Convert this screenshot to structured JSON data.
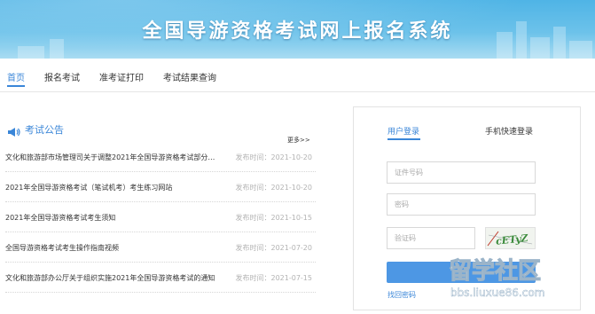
{
  "header": {
    "title": "全国导游资格考试网上报名系统"
  },
  "nav": {
    "items": [
      {
        "label": "首页",
        "active": true
      },
      {
        "label": "报名考试",
        "active": false
      },
      {
        "label": "准考证打印",
        "active": false
      },
      {
        "label": "考试结果查询",
        "active": false
      }
    ]
  },
  "notices": {
    "title": "考试公告",
    "icon": "megaphone-icon",
    "more_label": "更多>>",
    "items": [
      {
        "title": "文化和旅游部市场管理司关于调整2021年全国导游资格考试部分…",
        "date": "发布时间：2021-10-20"
      },
      {
        "title": "2021年全国导游资格考试（笔试机考）考生练习网站",
        "date": "发布时间：2021-10-20"
      },
      {
        "title": "2021年全国导游资格考试考生须知",
        "date": "发布时间：2021-10-15"
      },
      {
        "title": "全国导游资格考试考生操作指南视频",
        "date": "发布时间：2021-07-20"
      },
      {
        "title": "文化和旅游部办公厅关于组织实施2021年全国导游资格考试的通知",
        "date": "发布时间：2021-07-15"
      }
    ]
  },
  "login": {
    "tabs": [
      {
        "label": "用户登录",
        "active": true
      },
      {
        "label": "手机快速登录",
        "active": false
      }
    ],
    "id_placeholder": "证件号码",
    "password_placeholder": "密码",
    "captcha_placeholder": "验证码",
    "captcha_text": "cETyZ",
    "submit_label": "",
    "forgot_label": "找回密码"
  },
  "watermark": {
    "text": "留学社区",
    "url": "bbs.liuxue86.com"
  },
  "colors": {
    "accent": "#3a86d8",
    "button": "#4d97e4",
    "banner": "#5ab8e8",
    "muted_text": "#b3b3b3"
  }
}
